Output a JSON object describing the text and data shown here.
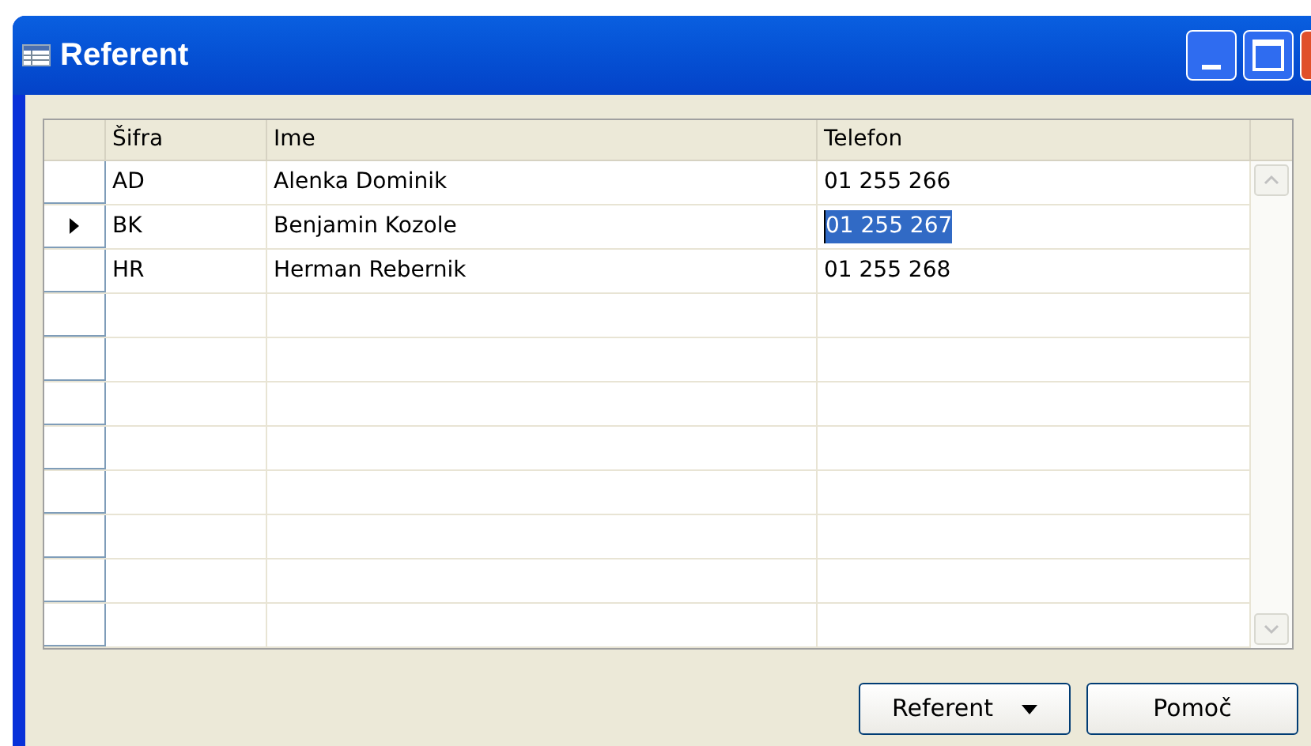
{
  "window": {
    "title": "Referent"
  },
  "table": {
    "columns": [
      "Šifra",
      "Ime",
      "Telefon"
    ],
    "rows": [
      {
        "cells": [
          "AD",
          "Alenka Dominik",
          "01 255 266"
        ],
        "selected": false
      },
      {
        "cells": [
          "BK",
          "Benjamin Kozole",
          "01 255 267"
        ],
        "selected": true
      },
      {
        "cells": [
          "HR",
          "Herman Rebernik",
          "01 255 268"
        ],
        "selected": false
      }
    ]
  },
  "buttons": [
    {
      "label": "Referent",
      "kind": "dropdown"
    },
    {
      "label": "Pomoč",
      "kind": "plain"
    }
  ]
}
